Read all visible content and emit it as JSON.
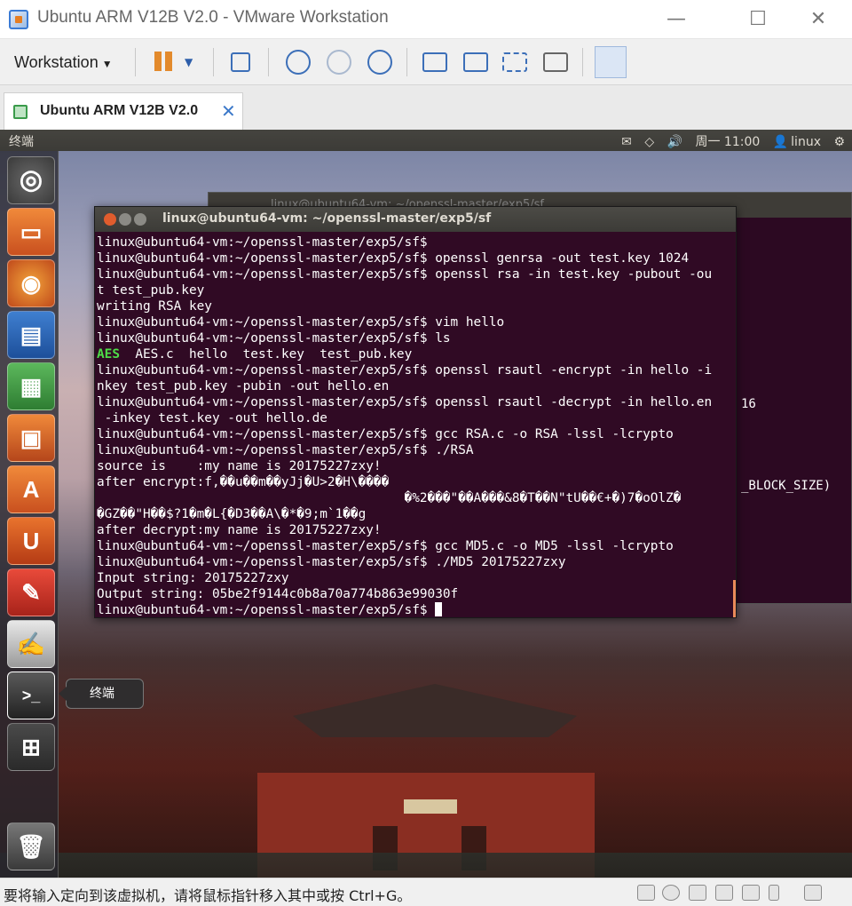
{
  "window": {
    "title": "Ubuntu ARM V12B V2.0 - VMware Workstation",
    "minimize": "—",
    "maximize": "☐",
    "close": "✕"
  },
  "toolbar": {
    "menu_label": "Workstation",
    "icons": [
      "pause-icon",
      "dropdown-icon",
      "network-icon",
      "snapshot-take-icon",
      "snapshot-revert-icon",
      "snapshot-manager-icon",
      "console-view-icon",
      "fullscreen-icon",
      "fit-guest-icon",
      "unity-icon",
      "thumbnail-icon"
    ]
  },
  "tab": {
    "label": "Ubuntu ARM V12B V2.0",
    "close": "✕"
  },
  "ubuntu_panel": {
    "app_title": "终端",
    "clock": "周一 11:00",
    "user": "linux",
    "icons": [
      "mail-icon",
      "wifi-icon",
      "volume-icon",
      "user-icon",
      "gear-icon"
    ]
  },
  "launcher": {
    "tooltip": "终端",
    "items": [
      "dash",
      "files",
      "firefox",
      "writer",
      "calc",
      "impress",
      "software-center",
      "ubuntu-one",
      "settings",
      "text-editor",
      "terminal",
      "workspace-switcher",
      "trash"
    ]
  },
  "background_terminal": {
    "title": "linux@ubuntu64-vm: ~/openssl-master/exp5/sf",
    "fragment_1": "16",
    "fragment_2": "_BLOCK_SIZE)"
  },
  "terminal": {
    "title": "linux@ubuntu64-vm: ~/openssl-master/exp5/sf",
    "lines": [
      "linux@ubuntu64-vm:~/openssl-master/exp5/sf$",
      "linux@ubuntu64-vm:~/openssl-master/exp5/sf$ openssl genrsa -out test.key 1024",
      "linux@ubuntu64-vm:~/openssl-master/exp5/sf$ openssl rsa -in test.key -pubout -ou",
      "t test_pub.key",
      "writing RSA key",
      "linux@ubuntu64-vm:~/openssl-master/exp5/sf$ vim hello",
      "linux@ubuntu64-vm:~/openssl-master/exp5/sf$ ls",
      "AES  AES.c  hello  test.key  test_pub.key",
      "linux@ubuntu64-vm:~/openssl-master/exp5/sf$ openssl rsautl -encrypt -in hello -i",
      "nkey test_pub.key -pubin -out hello.en",
      "linux@ubuntu64-vm:~/openssl-master/exp5/sf$ openssl rsautl -decrypt -in hello.en",
      " -inkey test.key -out hello.de",
      "linux@ubuntu64-vm:~/openssl-master/exp5/sf$ gcc RSA.c -o RSA -lssl -lcrypto",
      "linux@ubuntu64-vm:~/openssl-master/exp5/sf$ ./RSA",
      "source is    :my name is 20175227zxy!",
      "after encrypt:f,��u��m��yJj�U>2�H\\����",
      "                                        �%2���\"��A���&8�T��N\"tU��€+�)7�oOlZ�",
      "�GZ��\"H��$?1�m�L{�D3��A\\�*�9;m`1��g",
      "after decrypt:my name is 20175227zxy!",
      "linux@ubuntu64-vm:~/openssl-master/exp5/sf$ gcc MD5.c -o MD5 -lssl -lcrypto",
      "linux@ubuntu64-vm:~/openssl-master/exp5/sf$ ./MD5 20175227zxy",
      "Input string: 20175227zxy",
      "Output string: 05be2f9144c0b8a70a774b863e99030f",
      "linux@ubuntu64-vm:~/openssl-master/exp5/sf$ "
    ],
    "ls_highlight": "AES",
    "ls_rest": "  AES.c  hello  test.key  test_pub.key"
  },
  "statusbar": {
    "message": "要将输入定向到该虚拟机，请将鼠标指针移入其中或按 Ctrl+G。",
    "icons": [
      "hdd-icon",
      "cd-icon",
      "network-adapter-icon",
      "printer-icon",
      "sound-icon",
      "usb-icon",
      "message-icon"
    ]
  },
  "colors": {
    "terminal_bg": "#300a24",
    "ls_exec": "#4edc48",
    "ubuntu_close": "#e05c2d"
  }
}
